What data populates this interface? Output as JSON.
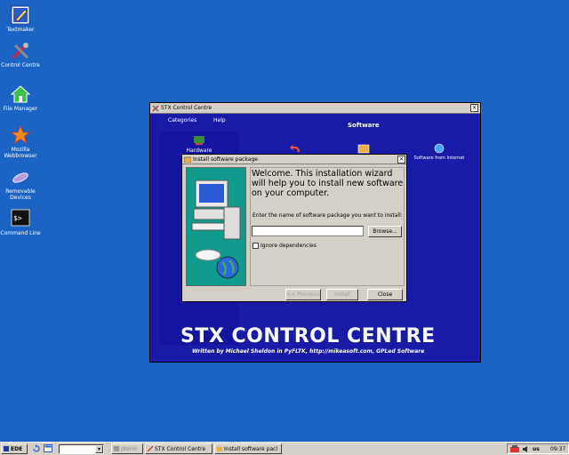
{
  "desktop": {
    "icons": [
      {
        "label": "Textmaker",
        "icon": "textmaker-icon"
      },
      {
        "label": "Control Centre",
        "icon": "control-centre-icon"
      },
      {
        "label": "File Manager",
        "icon": "home-icon"
      },
      {
        "label": "Mozilla Webbrowser",
        "icon": "star-icon"
      },
      {
        "label": "Removable Devices",
        "icon": "removable-icon"
      },
      {
        "label": "Command Line",
        "icon": "terminal-icon"
      }
    ]
  },
  "stx": {
    "title": "STX Control Centre",
    "menu": [
      "Categories",
      "Help"
    ],
    "section": "Software",
    "sidebar_item": "Hardware",
    "tool_internet": "Software from Internet",
    "brand": "STX CONTROL CENTRE",
    "subtitle": "Written by Michael Sheldon in PyFLTK, http://mikeasoft.com, GPLed Software",
    "close_glyph": "×"
  },
  "dialog": {
    "title": "Install software package",
    "welcome": "Welcome. This installation wizard will help you to install new software on your computer.",
    "prompt": "Enter the name of software package you want to install:",
    "input_value": "",
    "browse": "Browse...",
    "ignore_deps": "Ignore dependencies",
    "previous": "<< Previous",
    "install": "Install",
    "close": "Close",
    "close_glyph": "×"
  },
  "taskbar": {
    "start": "EDE",
    "items": [
      "pterm",
      "STX Control Centre",
      "Install software pacl"
    ],
    "lang": "us",
    "clock": "09:37"
  },
  "colors": {
    "desktop": "#1c64c4",
    "stx_bg": "#1a1aa8",
    "dialog_bg": "#d4d0c8"
  }
}
